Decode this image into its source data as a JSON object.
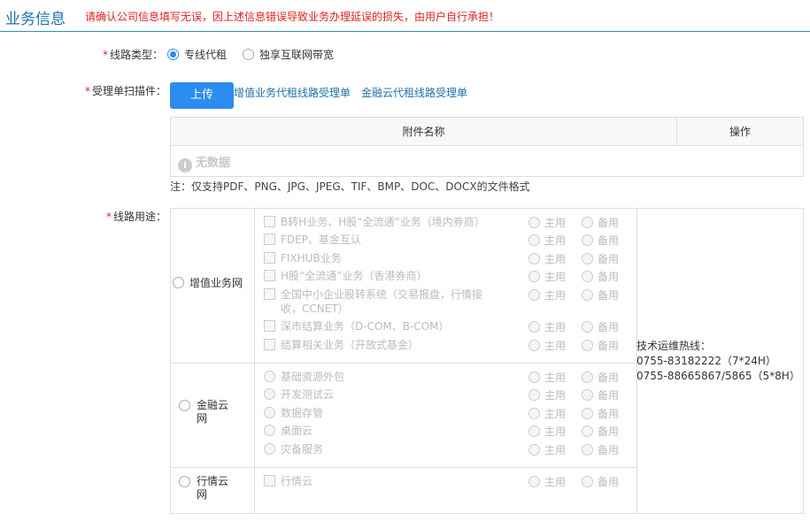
{
  "header": {
    "title": "业务信息",
    "warning": "请确认公司信息填写无误，因上述信息错误导致业务办理延误的损失，由用户自行承担！"
  },
  "line_type": {
    "label": "线路类型：",
    "options": [
      "专线代租",
      "独享互联网带宽"
    ],
    "selected": "专线代租"
  },
  "scan": {
    "label": "受理单扫描件：",
    "upload_label": "上传",
    "links": [
      "增值业务代租线路受理单",
      "金融云代租线路受理单"
    ]
  },
  "attachments": {
    "columns": [
      "附件名称",
      "操作"
    ],
    "empty_text": "无数据"
  },
  "note": "注：仅支持PDF、PNG、JPG、JPEG、TIF、BMP、DOC、DOCX的文件格式",
  "usage": {
    "label": "线路用途：",
    "primary_label": "主用",
    "backup_label": "备用",
    "groups": [
      {
        "name": "增值业务网",
        "services": [
          "B转H业务、H股“全流通”业务（境内券商）",
          "FDEP、基金互认",
          "FIXHUB业务",
          "H股“全流通”业务（香港券商）",
          "全国中小企业股转系统（交易报盘，行情接收，CCNET）",
          "深市结算业务（D-COM、B-COM）",
          "结算相关业务（开放式基金）"
        ]
      },
      {
        "name": "金融云网",
        "services": [
          "基础资源外包",
          "开发测试云",
          "数据存管",
          "桌面云",
          "灾备服务"
        ]
      },
      {
        "name": "行情云网",
        "services": [
          "行情云"
        ]
      }
    ],
    "hotline": {
      "title": "技术运维热线：",
      "lines": [
        "0755-83182222（7*24H）",
        "0755-88665867/5865（5*8H）"
      ]
    }
  },
  "colors": {
    "accent": "#2d8cf0",
    "title": "#1e6fa8",
    "warning": "#e02020",
    "disabled": "#bbbbbb"
  }
}
